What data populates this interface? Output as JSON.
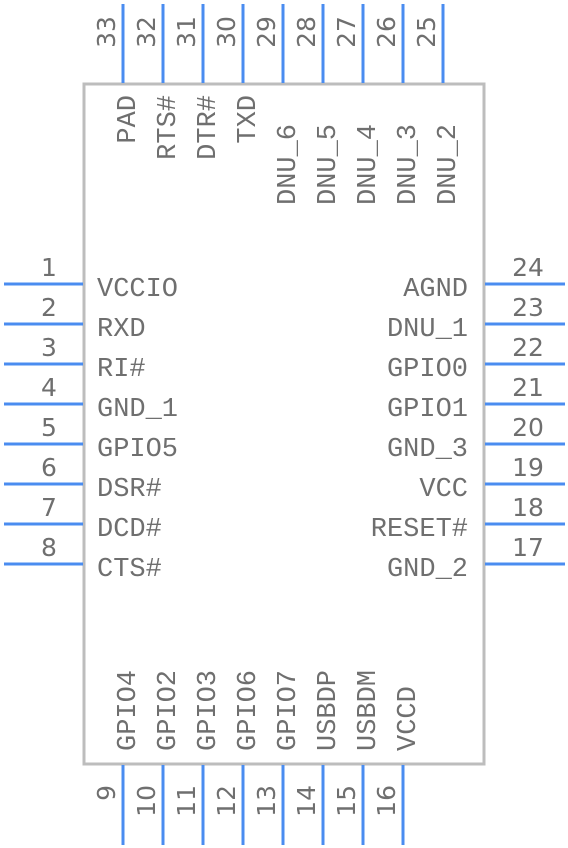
{
  "component": {
    "type": "IC symbol",
    "body_color": "#bdbdbd",
    "pin_color": "#4a8cf0",
    "text_color": "#6f6f6f"
  },
  "pins": {
    "left": [
      {
        "number": "1",
        "name": "VCCIO"
      },
      {
        "number": "2",
        "name": "RXD"
      },
      {
        "number": "3",
        "name": "RI#"
      },
      {
        "number": "4",
        "name": "GND_1"
      },
      {
        "number": "5",
        "name": "GPIO5"
      },
      {
        "number": "6",
        "name": "DSR#"
      },
      {
        "number": "7",
        "name": "DCD#"
      },
      {
        "number": "8",
        "name": "CTS#"
      }
    ],
    "bottom": [
      {
        "number": "9",
        "name": "GPIO4"
      },
      {
        "number": "10",
        "name": "GPIO2"
      },
      {
        "number": "11",
        "name": "GPIO3"
      },
      {
        "number": "12",
        "name": "GPIO6"
      },
      {
        "number": "13",
        "name": "GPIO7"
      },
      {
        "number": "14",
        "name": "USBDP"
      },
      {
        "number": "15",
        "name": "USBDM"
      },
      {
        "number": "16",
        "name": "VCCD"
      }
    ],
    "right": [
      {
        "number": "24",
        "name": "AGND"
      },
      {
        "number": "23",
        "name": "DNU_1"
      },
      {
        "number": "22",
        "name": "GPIO0"
      },
      {
        "number": "21",
        "name": "GPIO1"
      },
      {
        "number": "20",
        "name": "GND_3"
      },
      {
        "number": "19",
        "name": "VCC"
      },
      {
        "number": "18",
        "name": "RESET#"
      },
      {
        "number": "17",
        "name": "GND_2"
      }
    ],
    "top": [
      {
        "number": "33",
        "name": "PAD"
      },
      {
        "number": "32",
        "name": "RTS#"
      },
      {
        "number": "31",
        "name": "DTR#"
      },
      {
        "number": "30",
        "name": "TXD"
      },
      {
        "number": "29",
        "name": "DNU_6"
      },
      {
        "number": "28",
        "name": "DNU_5"
      },
      {
        "number": "27",
        "name": "DNU_4"
      },
      {
        "number": "26",
        "name": "DNU_3"
      },
      {
        "number": "25",
        "name": "DNU_2"
      }
    ]
  }
}
